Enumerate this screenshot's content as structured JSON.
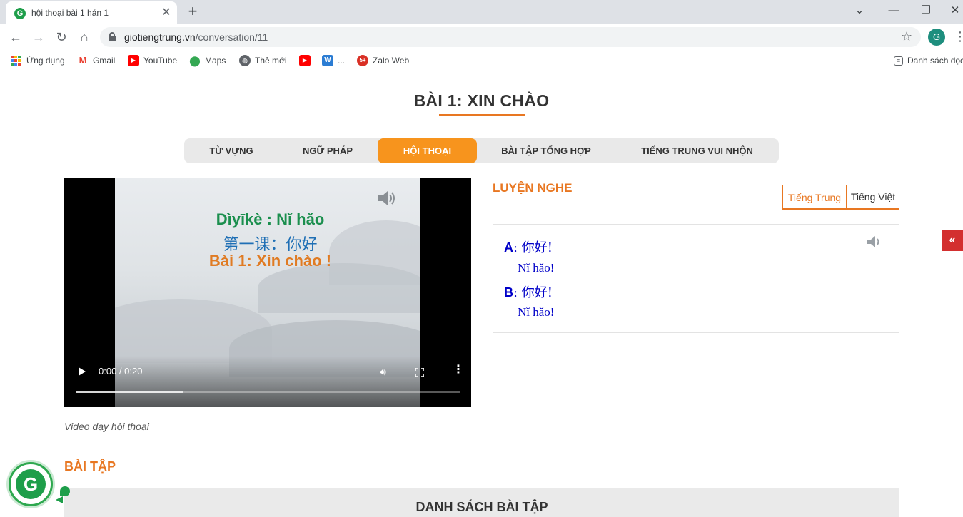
{
  "browser": {
    "tab_title": "hội thoại bài 1 hán 1",
    "url_host": "giotiengtrung.vn",
    "url_path": "/conversation/11",
    "profile_initial": "G",
    "bookmarks": {
      "apps": "Ứng dụng",
      "gmail": "Gmail",
      "youtube": "YouTube",
      "maps": "Maps",
      "new_tab": "Thẻ mới",
      "word_more": "...",
      "zalo": "Zalo Web",
      "reading_list": "Danh sách đọc"
    }
  },
  "page": {
    "title": "BÀI 1: XIN CHÀO",
    "nav_tabs": [
      {
        "label": "TỪ VỰNG"
      },
      {
        "label": "NGỮ PHÁP"
      },
      {
        "label": "HỘI THOẠI"
      },
      {
        "label": "BÀI TẬP TỔNG HỢP"
      },
      {
        "label": "TIẾNG TRUNG VUI NHỘN"
      }
    ],
    "active_tab": "HỘI THOẠI",
    "accent_color": "#f7941d",
    "video": {
      "line1": "Dìyīkè : Nǐ hǎo",
      "line2": "第一课：你好",
      "line3": "Bài 1: Xin chào !",
      "time": "0:00 / 0:20",
      "buffered_fraction": 0.28,
      "caption": "Video dạy hội thoại"
    },
    "listening": {
      "heading": "LUYỆN NGHE",
      "lang_tabs": [
        "Tiếng Trung",
        "Tiếng Việt"
      ],
      "active_lang": "Tiếng Trung",
      "lines": [
        {
          "speaker": "A",
          "chinese": "你好!",
          "pinyin": "Nǐ hǎo!"
        },
        {
          "speaker": "B",
          "chinese": "你好!",
          "pinyin": "Nǐ hǎo!"
        }
      ]
    },
    "side_toggle": "«",
    "exercises_heading": "BÀI TẬP",
    "exercise_list_title": "DANH SÁCH BÀI TẬP",
    "badge_letter": "G"
  }
}
